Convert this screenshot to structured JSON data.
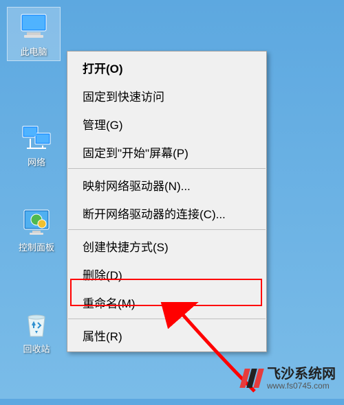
{
  "desktop": {
    "this_pc": "此电脑",
    "network": "网络",
    "control_panel": "控制面板",
    "recycle_bin": "回收站"
  },
  "context_menu": {
    "open": "打开(O)",
    "pin_quick": "固定到快速访问",
    "manage": "管理(G)",
    "pin_start": "固定到\"开始\"屏幕(P)",
    "map_drive": "映射网络驱动器(N)...",
    "disconnect_drive": "断开网络驱动器的连接(C)...",
    "create_shortcut": "创建快捷方式(S)",
    "delete": "删除(D)",
    "rename": "重命名(M)",
    "properties": "属性(R)"
  },
  "watermark": {
    "name": "飞沙系统网",
    "url": "www.fs0745.com"
  }
}
